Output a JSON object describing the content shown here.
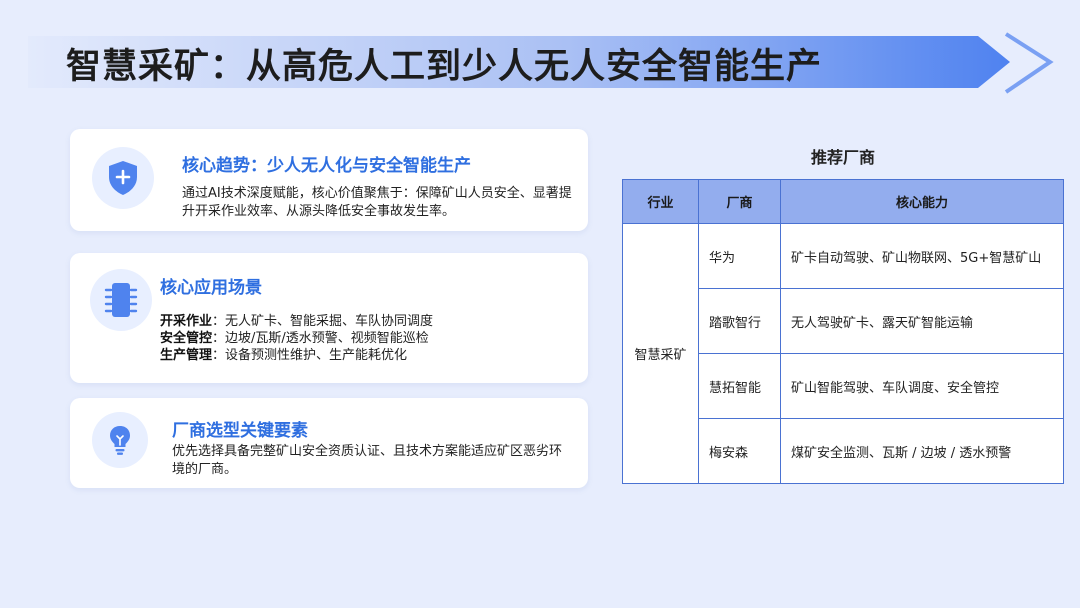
{
  "slide": {
    "title": "智慧采矿：从高危人工到少人无人安全智能生产"
  },
  "cards": [
    {
      "icon": "shield-plus-icon",
      "heading": "核心趋势：少人无人化与安全智能生产",
      "text": "通过AI技术深度赋能，核心价值聚焦于：保障矿山人员安全、显著提升开采作业效率、从源头降低安全事故发生率。"
    },
    {
      "icon": "chip-icon",
      "heading": "核心应用场景",
      "items": [
        {
          "label": "开采作业",
          "text": "：无人矿卡、智能采掘、车队协同调度"
        },
        {
          "label": "安全管控",
          "text": "：边坡/瓦斯/透水预警、视频智能巡检"
        },
        {
          "label": "生产管理",
          "text": "：设备预测性维护、生产能耗优化"
        }
      ]
    },
    {
      "icon": "lightbulb-icon",
      "heading": "厂商选型关键要素",
      "text": "优先选择具备完整矿山安全资质认证、且技术方案能适应矿区恶劣环境的厂商。"
    }
  ],
  "table": {
    "title": "推荐厂商",
    "headers": [
      "行业",
      "厂商",
      "核心能力"
    ],
    "industry": "智慧采矿",
    "rows": [
      {
        "vendor": "华为",
        "capability": "矿卡自动驾驶、矿山物联网、5G+智慧矿山"
      },
      {
        "vendor": "踏歌智行",
        "capability": "无人驾驶矿卡、露天矿智能运输"
      },
      {
        "vendor": "慧拓智能",
        "capability": "矿山智能驾驶、车队调度、安全管控"
      },
      {
        "vendor": "梅安森",
        "capability": "煤矿安全监测、瓦斯 / 边坡 / 透水预警"
      }
    ]
  },
  "colors": {
    "accent": "#2f6fe0",
    "background": "#e7edfd",
    "table_header": "#93adee",
    "table_border": "#4a72d2"
  }
}
